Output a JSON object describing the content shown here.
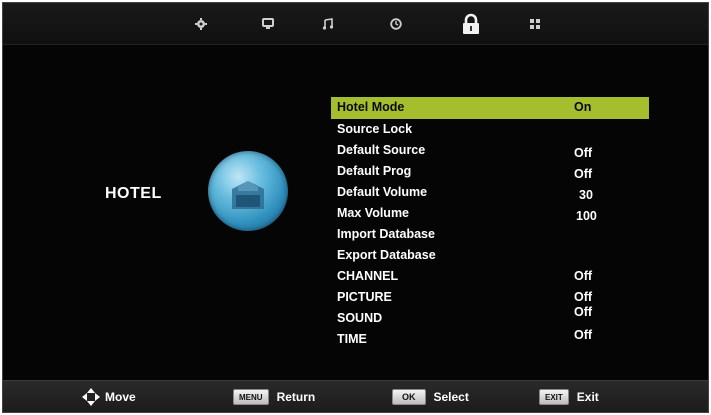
{
  "tabs": [
    {
      "name": "settings-icon",
      "selected": false
    },
    {
      "name": "picture-icon",
      "selected": false
    },
    {
      "name": "sound-icon",
      "selected": false
    },
    {
      "name": "time-icon",
      "selected": false
    },
    {
      "name": "lock-icon",
      "selected": true
    },
    {
      "name": "apps-icon",
      "selected": false
    }
  ],
  "section": {
    "title": "HOTEL",
    "icon": "hotel-globe-icon"
  },
  "menu": {
    "selected_index": 0,
    "items": [
      {
        "label": "Hotel Mode",
        "value": "On"
      },
      {
        "label": "Source Lock",
        "value": ""
      },
      {
        "label": "Default Source",
        "value": "Off"
      },
      {
        "label": "Default Prog",
        "value": "Off"
      },
      {
        "label": "Default Volume",
        "value": "30"
      },
      {
        "label": "Max Volume",
        "value": "100"
      },
      {
        "label": "Import Database",
        "value": ""
      },
      {
        "label": "Export Database",
        "value": ""
      },
      {
        "label": "CHANNEL",
        "value": "Off"
      },
      {
        "label": "PICTURE",
        "value": "Off"
      },
      {
        "label": "SOUND",
        "value": "Off"
      },
      {
        "label": "TIME",
        "value": "Off"
      }
    ]
  },
  "footer": {
    "move_label": "Move",
    "menu_key": "MENU",
    "return_label": "Return",
    "ok_key": "OK",
    "select_label": "Select",
    "exit_key": "EXIT",
    "exit_label": "Exit"
  },
  "colors": {
    "highlight": "#a5be2e",
    "background": "#050505"
  }
}
